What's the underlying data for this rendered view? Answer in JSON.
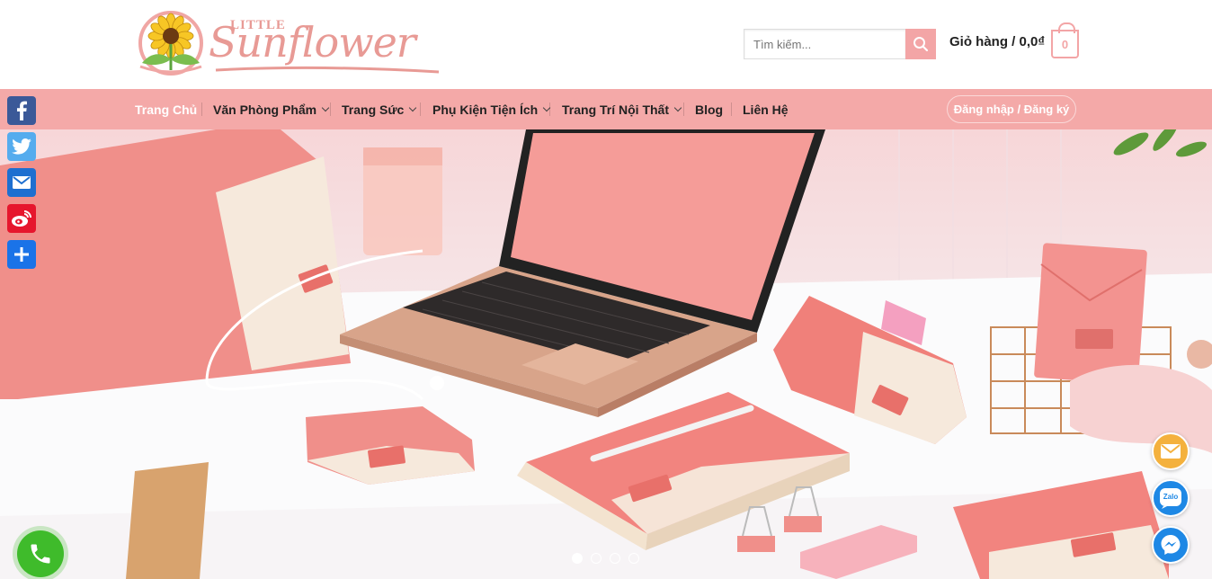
{
  "header": {
    "logo_little": "LITTLE",
    "logo_word": "Sunflower",
    "search": {
      "placeholder": "Tìm kiếm..."
    },
    "cart": {
      "label": "Giỏ hàng / 0,0₫",
      "count": "0"
    }
  },
  "nav": {
    "items": [
      {
        "label": "Trang Chủ",
        "active": true
      },
      {
        "label": "Văn Phòng Phẩm",
        "dropdown": true
      },
      {
        "label": "Trang Sức",
        "dropdown": true
      },
      {
        "label": "Phụ Kiện Tiện Ích",
        "dropdown": true
      },
      {
        "label": "Trang Trí Nội Thất",
        "dropdown": true
      },
      {
        "label": "Blog"
      },
      {
        "label": "Liên Hệ"
      }
    ],
    "login": "Đăng nhập / Đăng ký"
  },
  "social": [
    "facebook-icon",
    "twitter-icon",
    "email-icon",
    "weibo-icon",
    "share-icon"
  ],
  "slider": {
    "slides": 4,
    "active": 0
  },
  "floating": [
    "mail-icon",
    "zalo-icon",
    "messenger-icon",
    "phone-icon"
  ],
  "floating_labels": {
    "zalo": "Zalo"
  },
  "colors": {
    "brand_pink": "#f4a9a8",
    "facebook": "#3b5998",
    "twitter": "#55acee",
    "email": "#1e6fd0",
    "weibo": "#e6162d",
    "share": "#1a73e8",
    "phone": "#3fbb2b"
  }
}
